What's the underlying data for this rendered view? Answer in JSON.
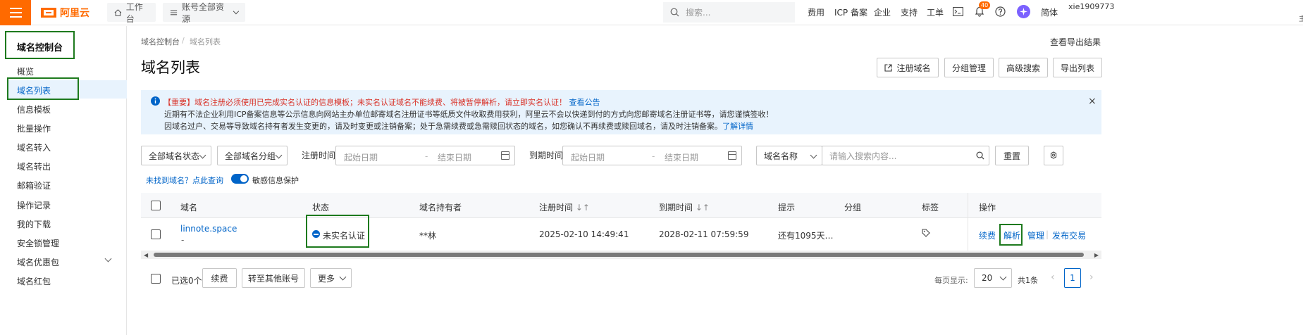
{
  "header": {
    "logo_text": "阿里云",
    "workbench": "工作台",
    "resources": "账号全部资源",
    "search_placeholder": "搜索...",
    "nav": [
      "费用",
      "ICP 备案",
      "企业",
      "支持",
      "工单"
    ],
    "notification_count": "40",
    "language": "简体",
    "user_name": "xie1909773",
    "user_sub": "主"
  },
  "sidebar": {
    "title": "域名控制台",
    "items": [
      "概览",
      "域名列表",
      "信息模板",
      "批量操作",
      "域名转入",
      "域名转出",
      "邮箱验证",
      "操作记录",
      "我的下载",
      "安全锁管理",
      "域名优惠包",
      "域名红包"
    ]
  },
  "breadcrumb": {
    "root": "域名控制台",
    "current": "域名列表"
  },
  "page": {
    "title": "域名列表",
    "view_export": "查看导出结果",
    "actions": [
      "注册域名",
      "分组管理",
      "高级搜索",
      "导出列表"
    ]
  },
  "notice": {
    "line1_important": "【重要】域名注册必须使用已完成实名认证的信息模板；未实名认证域名不能续费、将被暂停解析，请立即实名认证！",
    "line1_link": "查看公告",
    "line2": "近期有不法企业利用ICP备案信息等公示信息向网站主办单位邮寄域名注册证书等纸质文件收取费用获利，阿里云不会以快递到付的方式向您邮寄域名注册证书等，请您谨慎签收！",
    "line3": "因域名过户、交易等导致域名持有者发生变更的，请及时变更或注销备案；处于急需续费或急需赎回状态的域名，如您确认不再续费或赎回域名，请及时注销备案。",
    "line3_link": "了解详情"
  },
  "filters": {
    "status": "全部域名状态",
    "group": "全部域名分组",
    "reg_time_label": "注册时间",
    "start_placeholder": "起始日期",
    "end_placeholder": "结束日期",
    "exp_time_label": "到期时间",
    "search_field": "域名名称",
    "search_placeholder": "请输入搜索内容...",
    "reset": "重置",
    "not_found": "未找到域名？点此查询",
    "sensitive": "敏感信息保护"
  },
  "table": {
    "headers": [
      "域名",
      "状态",
      "域名持有者",
      "注册时间",
      "到期时间",
      "提示",
      "分组",
      "标签",
      "操作"
    ],
    "rows": [
      {
        "domain": "linnote.space",
        "sub": "-",
        "status": "未实名认证",
        "owner": "**林",
        "reg_time": "2025-02-10 14:49:41",
        "exp_time": "2028-02-11 07:59:59",
        "hint": "还有1095天…",
        "ops": [
          "续费",
          "解析",
          "管理",
          "发布交易"
        ]
      }
    ]
  },
  "footer": {
    "selected": "已选0个",
    "renew": "续费",
    "transfer": "转至其他账号",
    "more": "更多",
    "per_page_label": "每页显示:",
    "per_page": "20",
    "total_pages": "共1条",
    "current_page": "1"
  },
  "colors": {
    "brand": "#ff6a00",
    "link": "#0064c8",
    "highlight": "#1e7a1e",
    "notice_bg": "#e8f3fd"
  }
}
